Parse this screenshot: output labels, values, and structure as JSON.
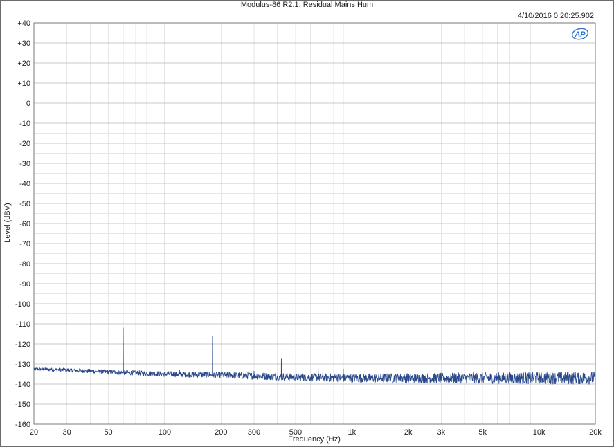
{
  "header": {
    "title": "Modulus-86 R2.1: Residual Mains Hum",
    "timestamp": "4/10/2016 0:20:25.902",
    "logo_text": "AP"
  },
  "colors": {
    "trace": "#2b4a8c",
    "grid_major": "#c8c8c8",
    "grid_minor": "#e6e6e6",
    "logo": "#2a6fd6"
  },
  "chart_data": {
    "type": "line",
    "title": "Modulus-86 R2.1: Residual Mains Hum",
    "xlabel": "Frequency (Hz)",
    "ylabel": "Level (dBV)",
    "xscale": "log",
    "xlim": [
      20,
      20000
    ],
    "ylim": [
      -160,
      40
    ],
    "grid": true,
    "x_ticks": [
      {
        "v": 20,
        "label": "20"
      },
      {
        "v": 30,
        "label": "30"
      },
      {
        "v": 50,
        "label": "50"
      },
      {
        "v": 100,
        "label": "100"
      },
      {
        "v": 200,
        "label": "200"
      },
      {
        "v": 300,
        "label": "300"
      },
      {
        "v": 500,
        "label": "500"
      },
      {
        "v": 1000,
        "label": "1k"
      },
      {
        "v": 2000,
        "label": "2k"
      },
      {
        "v": 3000,
        "label": "3k"
      },
      {
        "v": 5000,
        "label": "5k"
      },
      {
        "v": 10000,
        "label": "10k"
      },
      {
        "v": 20000,
        "label": "20k"
      }
    ],
    "y_ticks": [
      {
        "v": 40,
        "label": "+40"
      },
      {
        "v": 30,
        "label": "+30"
      },
      {
        "v": 20,
        "label": "+20"
      },
      {
        "v": 10,
        "label": "+10"
      },
      {
        "v": 0,
        "label": "0"
      },
      {
        "v": -10,
        "label": "-10"
      },
      {
        "v": -20,
        "label": "-20"
      },
      {
        "v": -30,
        "label": "-30"
      },
      {
        "v": -40,
        "label": "-40"
      },
      {
        "v": -50,
        "label": "-50"
      },
      {
        "v": -60,
        "label": "-60"
      },
      {
        "v": -70,
        "label": "-70"
      },
      {
        "v": -80,
        "label": "-80"
      },
      {
        "v": -90,
        "label": "-90"
      },
      {
        "v": -100,
        "label": "-100"
      },
      {
        "v": -110,
        "label": "-110"
      },
      {
        "v": -120,
        "label": "-120"
      },
      {
        "v": -130,
        "label": "-130"
      },
      {
        "v": -140,
        "label": "-140"
      },
      {
        "v": -150,
        "label": "-150"
      },
      {
        "v": -160,
        "label": "-160"
      }
    ],
    "series": [
      {
        "noise_floor": {
          "x": [
            20,
            30,
            50,
            100,
            200,
            500,
            1000,
            2000,
            5000,
            10000,
            20000
          ],
          "y": [
            -132.5,
            -133,
            -134,
            -135,
            -135.5,
            -136.5,
            -137,
            -137,
            -137,
            -137,
            -137
          ]
        },
        "peaks": [
          {
            "x": 60,
            "y": -112
          },
          {
            "x": 120,
            "y": -133
          },
          {
            "x": 180,
            "y": -116
          },
          {
            "x": 300,
            "y": -133.5
          },
          {
            "x": 420,
            "y": -127.5
          },
          {
            "x": 660,
            "y": -130.5
          },
          {
            "x": 900,
            "y": -132.5
          }
        ]
      }
    ]
  }
}
